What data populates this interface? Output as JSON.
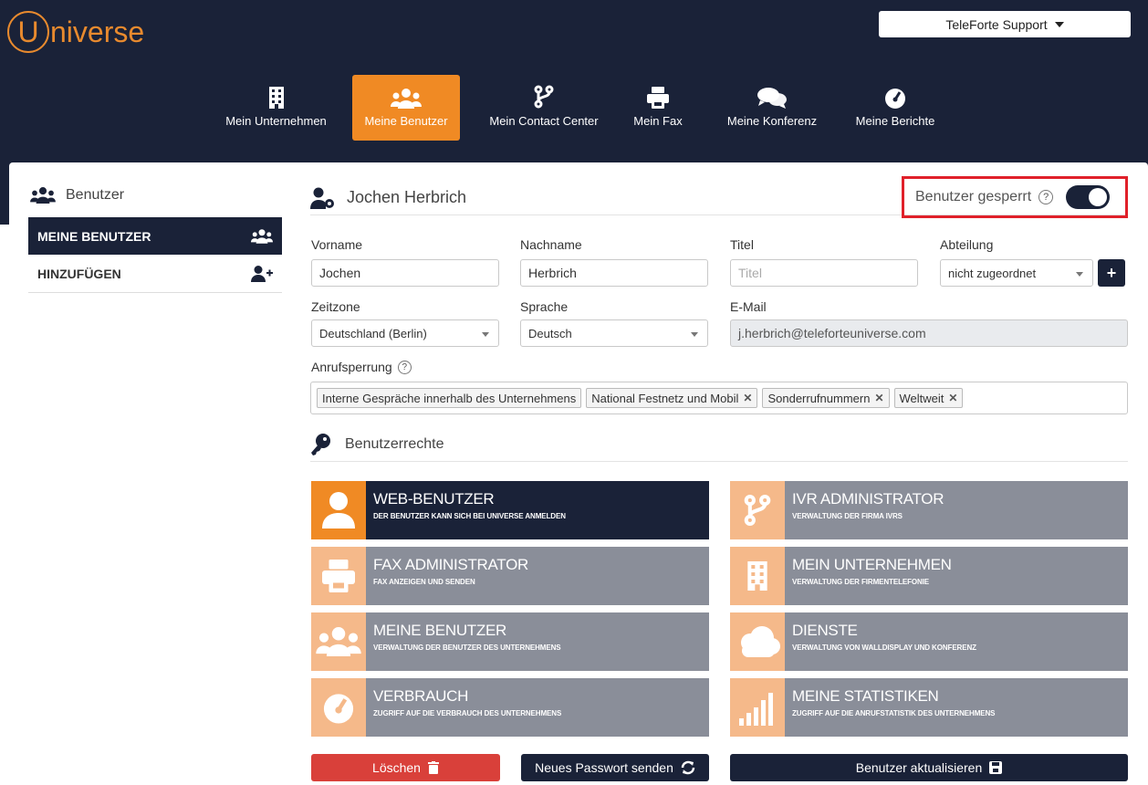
{
  "app": {
    "logo_letter": "U",
    "logo_text": "niverse"
  },
  "account": {
    "label": "TeleForte Support"
  },
  "nav": [
    {
      "label": "Mein Unternehmen",
      "icon": "building-icon"
    },
    {
      "label": "Meine Benutzer",
      "icon": "users-icon",
      "active": true
    },
    {
      "label": "Mein Contact Center",
      "icon": "branch-icon"
    },
    {
      "label": "Mein Fax",
      "icon": "printer-icon"
    },
    {
      "label": "Meine Konferenz",
      "icon": "chat-icon"
    },
    {
      "label": "Meine Berichte",
      "icon": "gauge-icon"
    }
  ],
  "sidebar": {
    "title": "Benutzer",
    "items": [
      {
        "label": "MEINE BENUTZER",
        "icon": "users-icon",
        "active": true
      },
      {
        "label": "HINZUFÜGEN",
        "icon": "user-plus-icon"
      }
    ]
  },
  "user": {
    "name": "Jochen Herbrich",
    "locked_label": "Benutzer gesperrt",
    "locked": true
  },
  "form": {
    "vorname_label": "Vorname",
    "vorname": "Jochen",
    "nachname_label": "Nachname",
    "nachname": "Herbrich",
    "titel_label": "Titel",
    "titel_placeholder": "Titel",
    "abteilung_label": "Abteilung",
    "abteilung": "nicht zugeordnet",
    "zeitzone_label": "Zeitzone",
    "zeitzone": "Deutschland (Berlin)",
    "sprache_label": "Sprache",
    "sprache": "Deutsch",
    "email_label": "E-Mail",
    "email": "j.herbrich@teleforteuniverse.com",
    "sperre_label": "Anrufsperrung",
    "sperre_tags": [
      "Interne Gespräche innerhalb des Unternehmens",
      "National Festnetz und Mobil",
      "Sonderrufnummern",
      "Weltweit"
    ]
  },
  "rights": {
    "title": "Benutzerrechte",
    "cards": [
      {
        "title": "WEB-BENUTZER",
        "sub": "DER BENUTZER KANN SICH BEI UNIVERSE ANMELDEN",
        "icon": "user-icon",
        "active": true
      },
      {
        "title": "IVR ADMINISTRATOR",
        "sub": "VERWALTUNG DER FIRMA IVRS",
        "icon": "branch-icon",
        "active": false
      },
      {
        "title": "FAX ADMINISTRATOR",
        "sub": "FAX ANZEIGEN UND SENDEN",
        "icon": "printer-icon",
        "active": false
      },
      {
        "title": "MEIN UNTERNEHMEN",
        "sub": "VERWALTUNG DER FIRMENTELEFONIE",
        "icon": "building-icon",
        "active": false
      },
      {
        "title": "MEINE BENUTZER",
        "sub": "VERWALTUNG DER BENUTZER DES UNTERNEHMENS",
        "icon": "users-icon",
        "active": false
      },
      {
        "title": "DIENSTE",
        "sub": "VERWALTUNG VON WALLDISPLAY UND KONFERENZ",
        "icon": "cloud-icon",
        "active": false
      },
      {
        "title": "VERBRAUCH",
        "sub": "ZUGRIFF AUF DIE VERBRAUCH DES UNTERNEHMENS",
        "icon": "gauge-icon",
        "active": false
      },
      {
        "title": "MEINE STATISTIKEN",
        "sub": "ZUGRIFF AUF DIE ANRUFSTATISTIK DES UNTERNEHMENS",
        "icon": "bar-chart-icon",
        "active": false
      }
    ]
  },
  "buttons": {
    "delete": "Löschen",
    "new_password": "Neues Passwort senden",
    "update": "Benutzer aktualisieren"
  },
  "colors": {
    "navy": "#1a2238",
    "orange": "#f08a24",
    "danger": "#d9403a",
    "highlight": "#e0202a"
  }
}
